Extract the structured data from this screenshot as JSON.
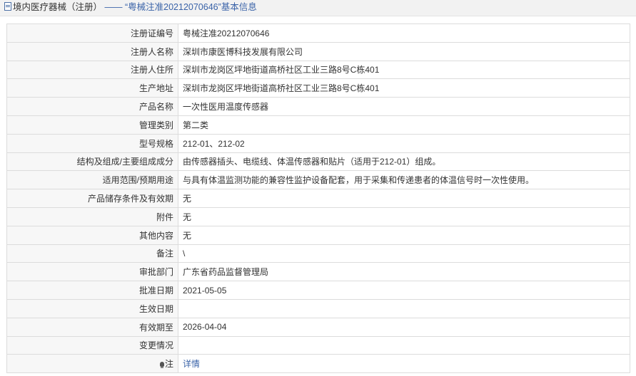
{
  "header": {
    "title_prefix": "境内医疗器械（注册）",
    "title_separator": "——",
    "title_main": "“粤械注准20212070646”基本信息"
  },
  "rows": [
    {
      "label": "注册证编号",
      "value": "粤械注准20212070646"
    },
    {
      "label": "注册人名称",
      "value": "深圳市康医博科技发展有限公司"
    },
    {
      "label": "注册人住所",
      "value": "深圳市龙岗区坪地街道高桥社区工业三路8号C栋401"
    },
    {
      "label": "生产地址",
      "value": "深圳市龙岗区坪地街道高桥社区工业三路8号C栋401"
    },
    {
      "label": "产品名称",
      "value": "一次性医用温度传感器"
    },
    {
      "label": "管理类别",
      "value": "第二类"
    },
    {
      "label": "型号规格",
      "value": "212-01、212-02"
    },
    {
      "label": "结构及组成/主要组成成分",
      "value": "由传感器插头、电缆线、体温传感器和贴片（适用于212-01）组成。"
    },
    {
      "label": "适用范围/预期用途",
      "value": "与具有体温监测功能的兼容性监护设备配套，用于采集和传递患者的体温信号时一次性使用。"
    },
    {
      "label": "产品储存条件及有效期",
      "value": "无"
    },
    {
      "label": "附件",
      "value": "无"
    },
    {
      "label": "其他内容",
      "value": "无"
    },
    {
      "label": "备注",
      "value": "\\"
    },
    {
      "label": "审批部门",
      "value": "广东省药品监督管理局"
    },
    {
      "label": "批准日期",
      "value": "2021-05-05"
    },
    {
      "label": "生效日期",
      "value": ""
    },
    {
      "label": "有效期至",
      "value": "2026-04-04"
    },
    {
      "label": "变更情况",
      "value": ""
    }
  ],
  "note": {
    "label": "注",
    "link_text": "详情",
    "icon": "lightbulb-icon"
  },
  "colors": {
    "link": "#3a63a8",
    "label_bg": "#f7f7f7",
    "border": "#dcdcdc",
    "titlebar_bg": "#f2f2f2"
  }
}
